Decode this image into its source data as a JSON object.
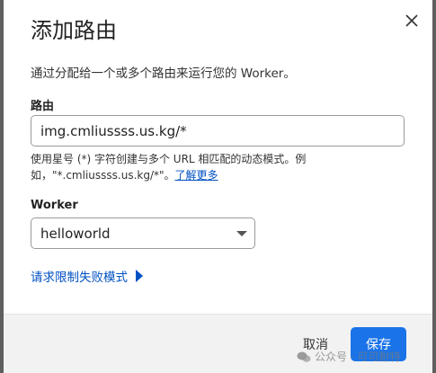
{
  "dialog": {
    "title": "添加路由",
    "description": "通过分配给一个或多个路由来运行您的 Worker。"
  },
  "route_field": {
    "label": "路由",
    "value": "img.cmliussss.us.kg/*"
  },
  "hint": {
    "line1": "使用星号 (*) 字符创建与多个 URL 相匹配的动态模式。例",
    "line2": "如，\"*.cmliussss.us.kg/*\"。",
    "learn_more": "了解更多"
  },
  "worker_field": {
    "label": "Worker",
    "selected": "helloworld"
  },
  "fail_mode_label": "请求限制失败模式",
  "footer": {
    "cancel_label": "取消",
    "save_label": "保存"
  },
  "watermark": "公众号 · 可可耐特",
  "colors": {
    "accent": "#0051c3",
    "primary_button": "#1a73e8"
  }
}
